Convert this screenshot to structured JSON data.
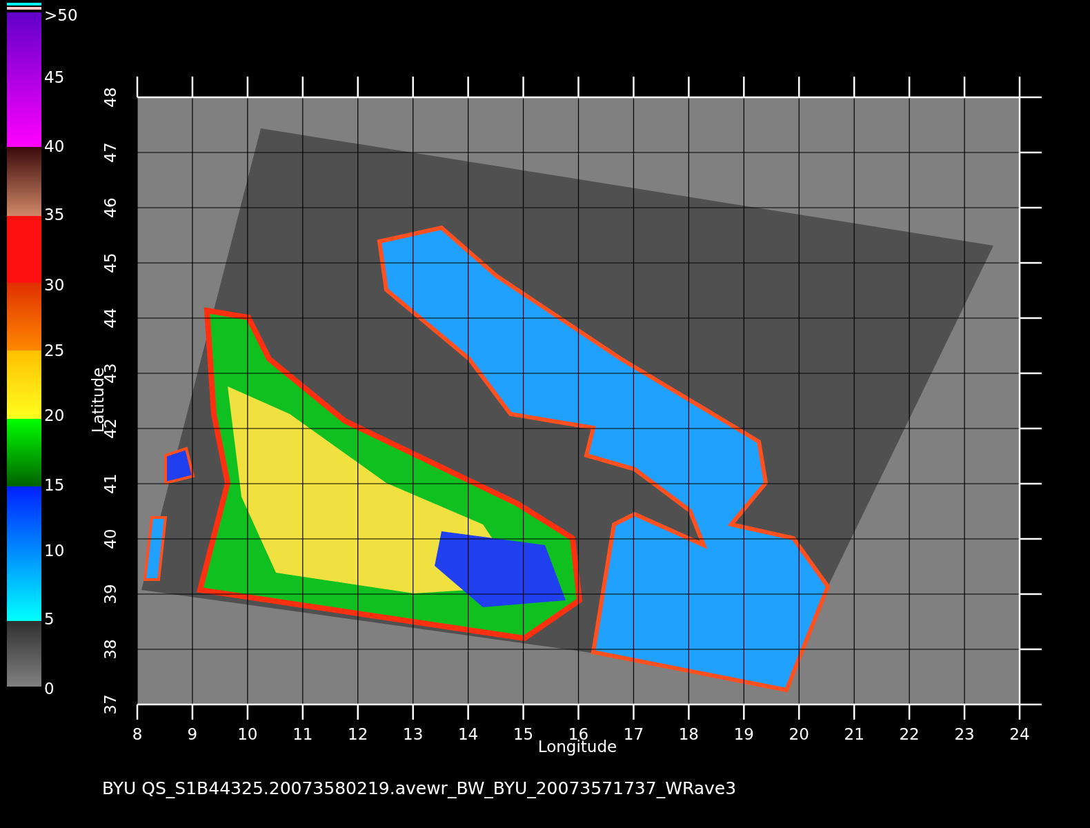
{
  "colorbar": {
    "labels": [
      ">50",
      "45",
      "40",
      "35",
      "30",
      "25",
      "20",
      "15",
      "10",
      "5",
      "0"
    ]
  },
  "y_axis": {
    "label": "Latitude",
    "ticks": [
      "37",
      "38",
      "39",
      "40",
      "41",
      "42",
      "43",
      "44",
      "45",
      "46",
      "47",
      "48"
    ]
  },
  "x_axis": {
    "label": "Longitude",
    "ticks": [
      "8",
      "9",
      "10",
      "11",
      "12",
      "13",
      "14",
      "15",
      "16",
      "17",
      "18",
      "19",
      "20",
      "21",
      "22",
      "23",
      "24"
    ]
  },
  "caption": "BYU  QS_S1B44325.20073580219.avewr_BW_BYU_20073571737_WRave3"
}
